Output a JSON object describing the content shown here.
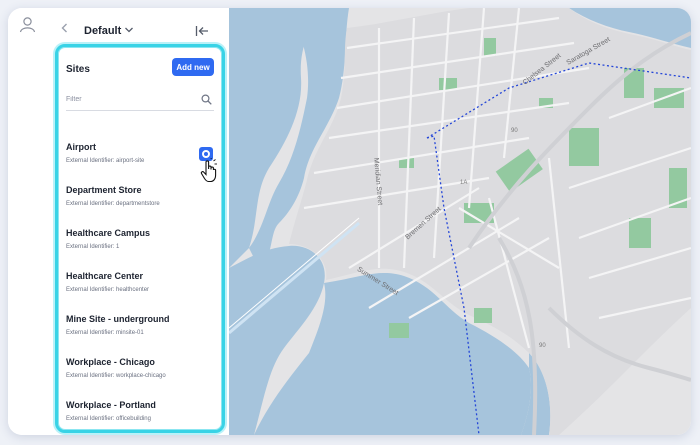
{
  "header": {
    "workspace": "Default"
  },
  "sites_panel": {
    "title": "Sites",
    "add_button": "Add new",
    "filter_placeholder": "Filter",
    "items": [
      {
        "name": "Airport",
        "identifier": "External Identifier: airport-site",
        "selected": true
      },
      {
        "name": "Department Store",
        "identifier": "External Identifier: departmentstore"
      },
      {
        "name": "Healthcare Campus",
        "identifier": "External Identifier: 1"
      },
      {
        "name": "Healthcare Center",
        "identifier": "External Identifier: healthcenter"
      },
      {
        "name": "Mine Site - underground",
        "identifier": "External Identifier: minsite-01"
      },
      {
        "name": "Workplace - Chicago",
        "identifier": "External Identifier: workplace-chicago"
      },
      {
        "name": "Workplace - Portland",
        "identifier": "External Identifier: officebuilding"
      }
    ]
  },
  "map": {
    "streets": [
      "Chelsea Street",
      "Saratoga Street",
      "Meridian Street",
      "Summer Street",
      "Bremen Street"
    ],
    "route_numbers": [
      "1A",
      "90",
      "90"
    ]
  },
  "colors": {
    "accent": "#2f6af1",
    "highlight": "#39d3e6",
    "water": "#a6c4dc",
    "park": "#93c9a0",
    "boundary": "#2446d8"
  },
  "icons": [
    "user-icon",
    "back-chevron-icon",
    "chevron-down-icon",
    "collapse-panel-icon",
    "search-icon",
    "pointer-hand-icon"
  ]
}
